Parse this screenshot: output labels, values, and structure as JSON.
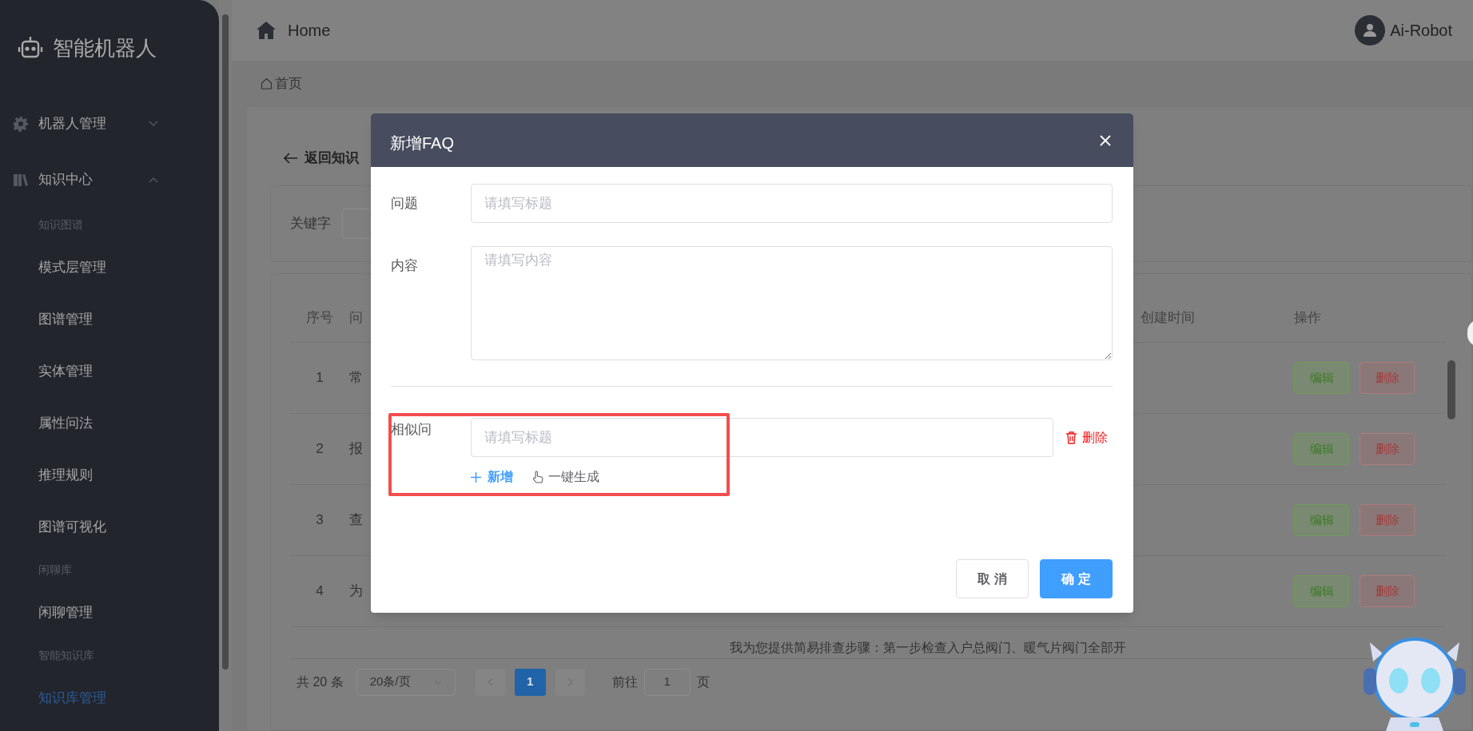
{
  "sidebar": {
    "title": "智能机器人",
    "menus": [
      {
        "label": "机器人管理",
        "expanded": false
      },
      {
        "label": "知识中心",
        "expanded": true,
        "children": [
          {
            "kind": "group",
            "label": "知识图谱"
          },
          {
            "kind": "item",
            "label": "模式层管理",
            "selected": false
          },
          {
            "kind": "item",
            "label": "图谱管理",
            "selected": false
          },
          {
            "kind": "item",
            "label": "实体管理",
            "selected": false
          },
          {
            "kind": "item",
            "label": "属性问法",
            "selected": false
          },
          {
            "kind": "item",
            "label": "推理规则",
            "selected": false
          },
          {
            "kind": "item",
            "label": "图谱可视化",
            "selected": false
          },
          {
            "kind": "group",
            "label": "闲聊库"
          },
          {
            "kind": "item",
            "label": "闲聊管理",
            "selected": false
          },
          {
            "kind": "group",
            "label": "智能知识库"
          },
          {
            "kind": "item",
            "label": "知识库管理",
            "selected": true
          }
        ]
      }
    ]
  },
  "header": {
    "title": "Home",
    "user": "Ai-Robot"
  },
  "breadcrumb": "首页",
  "back_link": "返回知识",
  "search": {
    "label": "关键字"
  },
  "table": {
    "columns": [
      "序号",
      "问",
      "创建时间",
      "操作"
    ],
    "rows": [
      {
        "index": "1",
        "question": "常",
        "actions": [
          "编辑",
          "删除"
        ]
      },
      {
        "index": "2",
        "question": "报",
        "actions": [
          "编辑",
          "删除"
        ]
      },
      {
        "index": "3",
        "question": "查",
        "actions": [
          "编辑",
          "删除"
        ]
      },
      {
        "index": "4",
        "question": "为",
        "actions": [
          "编辑",
          "删除"
        ]
      }
    ],
    "partial_row_text": "我为您提供简易排查步骤：第一步检查入户总阀门、暖气片阀门全部开"
  },
  "pagination": {
    "total": "共 20 条",
    "page_size": "20条/页",
    "pages": [
      {
        "label": "1",
        "selected": true
      }
    ],
    "goto_label": "前往",
    "goto_value": "1",
    "goto_suffix": "页"
  },
  "dialog": {
    "title": "新增FAQ",
    "fields": [
      {
        "kind": "input",
        "label": "问题",
        "placeholder": "请填写标题"
      },
      {
        "kind": "textarea",
        "label": "内容",
        "placeholder": "请填写内容"
      }
    ],
    "similar": {
      "label": "相似问",
      "highlighted": true,
      "items": [
        {
          "placeholder": "请填写标题",
          "delete": "删除"
        }
      ],
      "add": "新增",
      "generate": "一键生成"
    },
    "buttons": [
      {
        "kind": "default",
        "label": "取 消"
      },
      {
        "kind": "primary",
        "label": "确 定"
      }
    ]
  }
}
